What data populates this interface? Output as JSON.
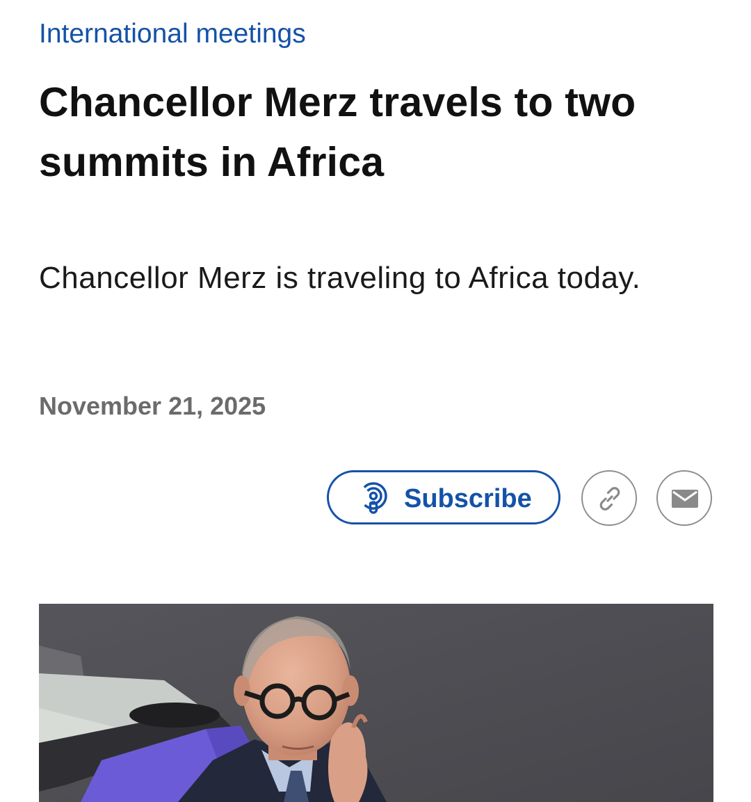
{
  "article": {
    "category": "International meetings",
    "headline": "Chancellor Merz travels to two summits in Africa",
    "teaser": "Chancellor Merz is traveling to Africa today.",
    "date": "November 21, 2025"
  },
  "share_bar": {
    "subscribe_label": "Subscribe",
    "subscribe_icon": "podcast-icon",
    "link_icon": "link-icon",
    "mail_icon": "mail-icon"
  },
  "colors": {
    "accent": "#1452a8",
    "text": "#111111",
    "muted": "#6b6b6b",
    "border": "#8e8e8e"
  },
  "image": {
    "subject": "Chancellor Merz portrait photo"
  }
}
